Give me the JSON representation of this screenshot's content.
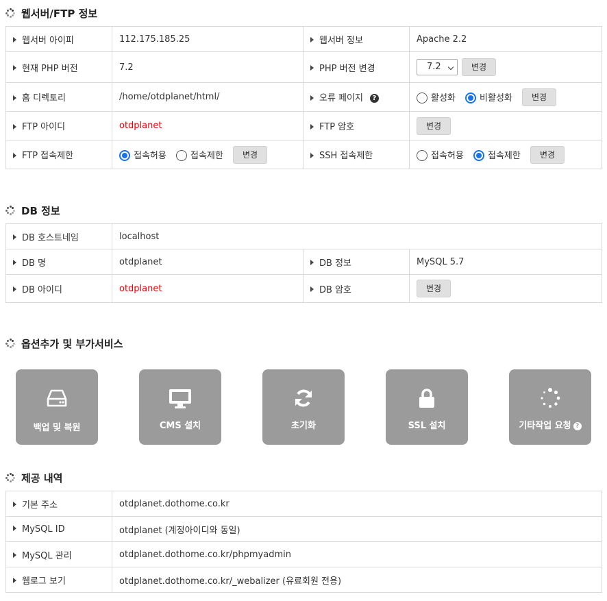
{
  "sections": {
    "web": "웹서버/FTP 정보",
    "db": "DB 정보",
    "options": "옵션추가 및 부가서비스",
    "provided": "제공 내역"
  },
  "web": {
    "server_ip_label": "웹서버 아이피",
    "server_ip": "112.175.185.25",
    "server_info_label": "웹서버 정보",
    "server_info": "Apache 2.2",
    "php_label": "현재 PHP 버전",
    "php_version": "7.2",
    "php_change_label": "PHP 버전 변경",
    "php_select_value": "7.2",
    "home_label": "홈 디렉토리",
    "home_dir": "/home/otdplanet/html/",
    "error_page_label": "오류 페이지",
    "error_on": "활성화",
    "error_off": "비활성화",
    "ftp_id_label": "FTP 아이디",
    "ftp_id": "otdplanet",
    "ftp_pw_label": "FTP 암호",
    "ftp_limit_label": "FTP 접속제한",
    "ftp_allow": "접속허용",
    "ftp_deny": "접속제한",
    "ssh_limit_label": "SSH 접속제한",
    "ssh_allow": "접속허용",
    "ssh_deny": "접속제한",
    "change": "변경"
  },
  "db": {
    "host_label": "DB 호스트네임",
    "host": "localhost",
    "name_label": "DB 명",
    "name": "otdplanet",
    "info_label": "DB 정보",
    "info": "MySQL 5.7",
    "id_label": "DB 아이디",
    "id": "otdplanet",
    "pw_label": "DB 암호",
    "change": "변경"
  },
  "tiles": {
    "backup": "백업 및 복원",
    "cms": "CMS 설치",
    "reset": "초기화",
    "ssl": "SSL 설치",
    "etc": "기타작업 요청"
  },
  "provided": {
    "base_label": "기본 주소",
    "base": "otdplanet.dothome.co.kr",
    "mysql_id_label": "MySQL ID",
    "mysql_id": "otdplanet (계정아이디와 동일)",
    "mysql_admin_label": "MySQL 관리",
    "mysql_admin": "otdplanet.dothome.co.kr/phpmyadmin",
    "weblog_label": "웹로그 보기",
    "weblog": "otdplanet.dothome.co.kr/_webalizer (유료회원 전용)"
  },
  "colors": {
    "accent": "#1a73e8",
    "red": "#ee0000",
    "tile": "#9b9b9b"
  }
}
